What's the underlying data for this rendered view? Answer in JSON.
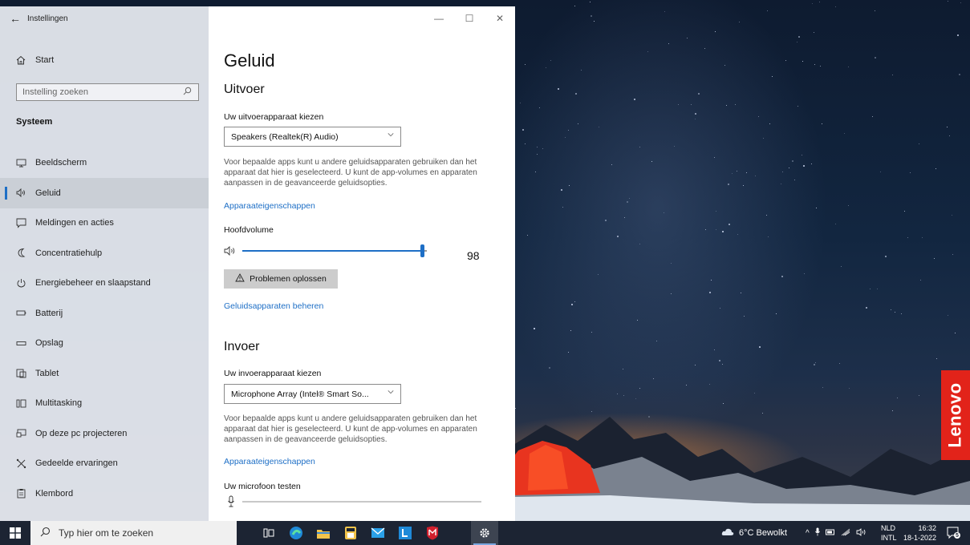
{
  "window": {
    "title": "Instellingen"
  },
  "sidebar": {
    "home_label": "Start",
    "search_placeholder": "Instelling zoeken",
    "section_label": "Systeem",
    "items": [
      {
        "label": "Beeldscherm",
        "icon": "monitor-icon"
      },
      {
        "label": "Geluid",
        "icon": "speaker-icon",
        "selected": true
      },
      {
        "label": "Meldingen en acties",
        "icon": "notification-icon"
      },
      {
        "label": "Concentratiehulp",
        "icon": "moon-icon"
      },
      {
        "label": "Energiebeheer en slaapstand",
        "icon": "power-icon"
      },
      {
        "label": "Batterij",
        "icon": "battery-icon"
      },
      {
        "label": "Opslag",
        "icon": "storage-icon"
      },
      {
        "label": "Tablet",
        "icon": "tablet-icon"
      },
      {
        "label": "Multitasking",
        "icon": "multitasking-icon"
      },
      {
        "label": "Op deze pc projecteren",
        "icon": "project-icon"
      },
      {
        "label": "Gedeelde ervaringen",
        "icon": "shared-experiences-icon"
      },
      {
        "label": "Klembord",
        "icon": "clipboard-icon"
      }
    ]
  },
  "content": {
    "page_title": "Geluid",
    "output": {
      "heading": "Uitvoer",
      "device_label": "Uw uitvoerapparaat kiezen",
      "device_value": "Speakers (Realtek(R) Audio)",
      "description": "Voor bepaalde apps kunt u andere geluidsapparaten gebruiken dan het apparaat dat hier is geselecteerd. U kunt de app-volumes en apparaten aanpassen in de geavanceerde geluidsopties.",
      "properties_link": "Apparaateigenschappen",
      "volume_label": "Hoofdvolume",
      "volume_value": "98",
      "volume_level": 0.98,
      "troubleshoot_label": "Problemen oplossen",
      "manage_link": "Geluidsapparaten beheren"
    },
    "input": {
      "heading": "Invoer",
      "device_label": "Uw invoerapparaat kiezen",
      "device_value": "Microphone Array (Intel® Smart So...",
      "description": "Voor bepaalde apps kunt u andere geluidsapparaten gebruiken dan het apparaat dat hier is geselecteerd. U kunt de app-volumes en apparaten aanpassen in de geavanceerde geluidsopties.",
      "properties_link": "Apparaateigenschappen",
      "test_label": "Uw microfoon testen",
      "mic_level": 0.0
    }
  },
  "taskbar": {
    "search_placeholder": "Typ hier om te zoeken",
    "weather": "6°C Bewolkt",
    "lang_top": "NLD",
    "lang_bottom": "INTL",
    "time": "16:32",
    "date": "18-1-2022",
    "notification_count": "5"
  },
  "wallpaper": {
    "brand": "Lenovo"
  },
  "colors": {
    "accent": "#1e6fc6",
    "taskbar": "#1c2433",
    "lenovo_red": "#e2231a"
  }
}
